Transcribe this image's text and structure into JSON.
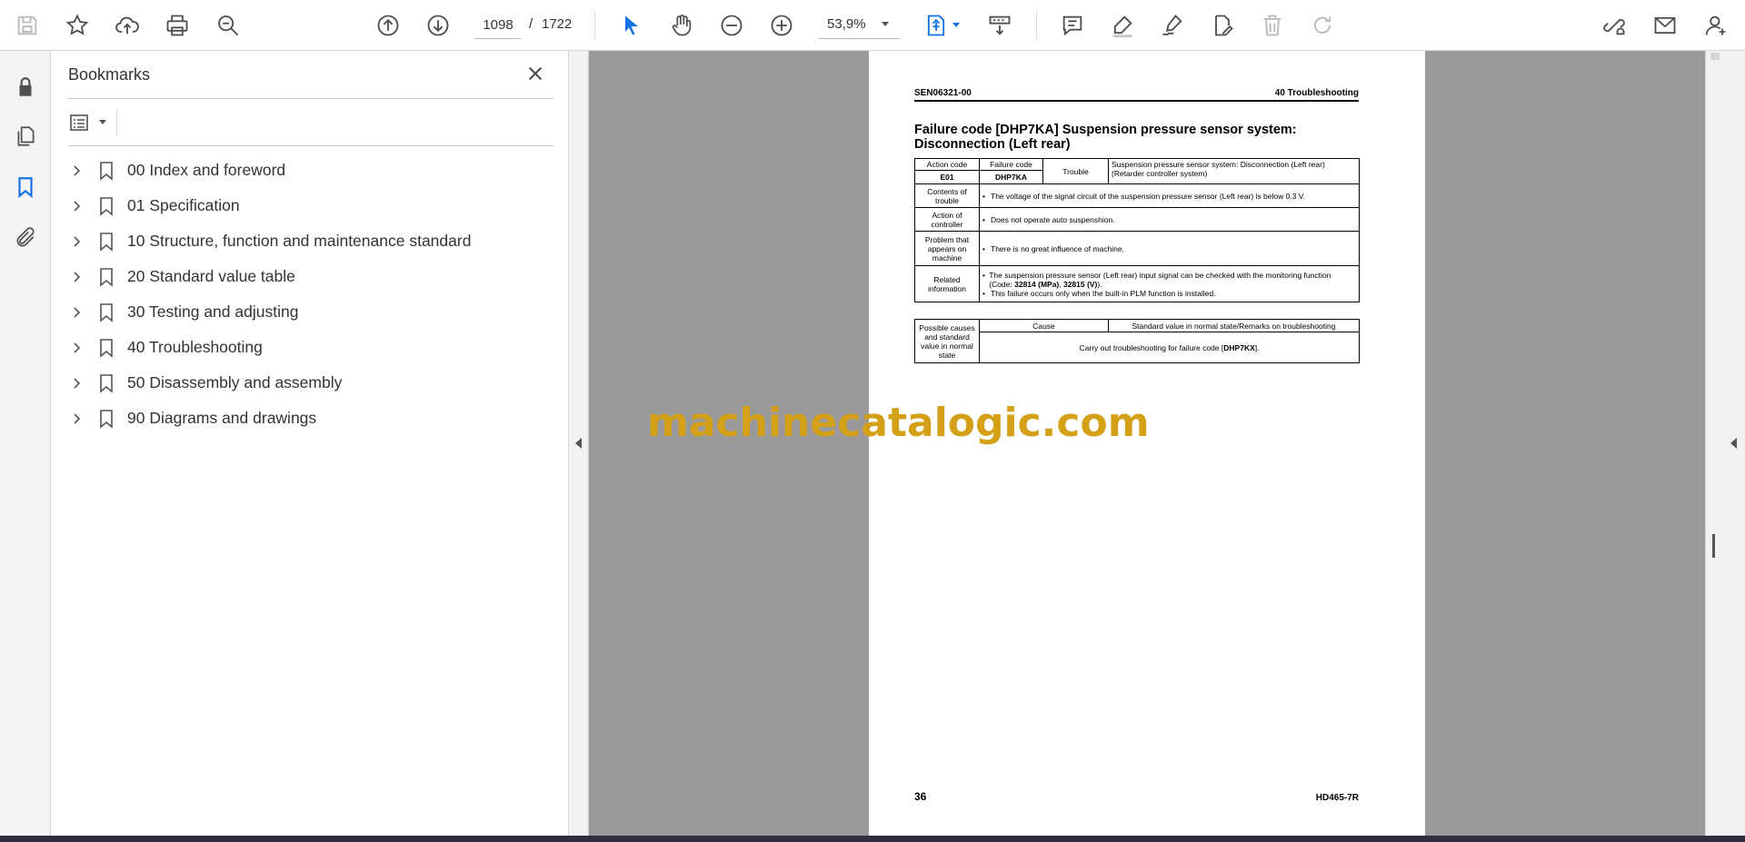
{
  "toolbar": {
    "current_page": "1098",
    "page_separator": "/",
    "total_pages": "1722",
    "zoom": "53,9%"
  },
  "icons": {
    "save": "save-icon",
    "bookmark_add": "star-icon",
    "upload": "cloud-upload-icon",
    "print": "print-icon",
    "find": "zoom-search-icon",
    "prev": "arrow-up-circle-icon",
    "next": "arrow-down-circle-icon",
    "zoom_out": "minus-circle-icon",
    "zoom_in": "plus-circle-icon",
    "select": "cursor-icon",
    "hand": "hand-icon",
    "fit": "fit-page-icon",
    "scroll": "scroll-mode-icon",
    "comment": "comment-icon",
    "highlight": "highlighter-icon",
    "sign": "sign-pen-icon",
    "edit": "edit-doc-icon",
    "delete": "trash-icon",
    "rotate": "rotate-icon",
    "share_link": "share-link-icon",
    "email": "mail-icon",
    "account": "account-icon"
  },
  "colors": {
    "accent": "#1473e6",
    "watermark": "#d4a017",
    "doc_bg": "#9a9a9a"
  },
  "bookmarks": {
    "title": "Bookmarks",
    "items": [
      {
        "label": "00 Index and foreword"
      },
      {
        "label": "01 Specification"
      },
      {
        "label": "10 Structure, function and maintenance standard"
      },
      {
        "label": "20 Standard value table"
      },
      {
        "label": "30 Testing and adjusting"
      },
      {
        "label": "40 Troubleshooting"
      },
      {
        "label": "50 Disassembly and assembly"
      },
      {
        "label": "90 Diagrams and drawings"
      }
    ]
  },
  "document": {
    "header_left": "SEN06321-00",
    "header_right": "40 Troubleshooting",
    "title": "Failure code [DHP7KA] Suspension pressure sensor system: Disconnection (Left rear)",
    "table1": {
      "action_code_label": "Action code",
      "failure_code_label": "Failure code",
      "trouble_label": "Trouble",
      "trouble_text": "Suspension pressure sensor system: Disconnection (Left rear) (Retarder controller system)",
      "action_code": "E01",
      "failure_code": "DHP7KA",
      "contents_label": "Contents of trouble",
      "contents_text": "The voltage of the signal circuit of the suspension pressure sensor (Left rear) is below 0.3 V.",
      "action_label": "Action of controller",
      "action_text": "Does not operate auto suspenshion.",
      "problem_label": "Problem that appears on machine",
      "problem_text": "There is no great  influence of machine.",
      "related_label": "Related information",
      "related_text_1a": "The suspension pressure sensor (Left rear) input signal can be checked with the monitoring function (Code: ",
      "related_code_1": "32814 (MPa)",
      "related_text_1b": ", ",
      "related_code_2": "32815 (V)",
      "related_text_1c": ").",
      "related_text_2": "This failure occurs only when the built-in PLM function is installed."
    },
    "table2": {
      "causes_label": "Possible causes and standard value in normal state",
      "cause_header": "Cause",
      "standard_header": "Standard value in normal state/Remarks on troubleshooting",
      "body_text_a": "Carry out troubleshooting for failure code [",
      "body_code": "DHP7KX",
      "body_text_b": "]."
    },
    "page_number": "36",
    "model": "HD465-7R"
  },
  "watermark": "machinecatalogic.com"
}
